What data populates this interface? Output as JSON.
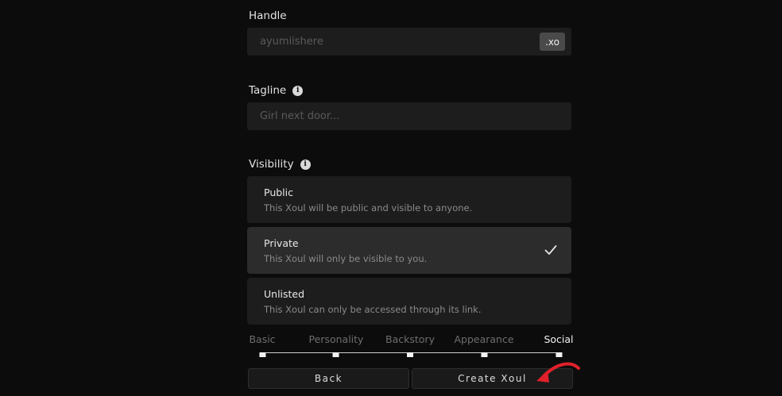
{
  "handle": {
    "label": "Handle",
    "placeholder": "ayumiishere",
    "suffix": ".xo"
  },
  "tagline": {
    "label": "Tagline",
    "placeholder": "Girl next door..."
  },
  "visibility": {
    "label": "Visibility",
    "options": [
      {
        "title": "Public",
        "desc": "This Xoul will be public and visible to anyone.",
        "selected": false
      },
      {
        "title": "Private",
        "desc": "This Xoul will only be visible to you.",
        "selected": true
      },
      {
        "title": "Unlisted",
        "desc": "This Xoul can only be accessed through its link.",
        "selected": false
      }
    ]
  },
  "steps": {
    "items": [
      "Basic",
      "Personality",
      "Backstory",
      "Appearance",
      "Social"
    ],
    "active_index": 4
  },
  "buttons": {
    "back": "Back",
    "create": "Create Xoul"
  },
  "colors": {
    "background": "#0c0c0c",
    "field": "#1d1d1d",
    "selected_option": "#2c2c2c",
    "arrow": "#e0202a"
  },
  "icons": {
    "info": "info-icon",
    "check": "check-icon",
    "arrow": "curved-arrow-icon"
  }
}
